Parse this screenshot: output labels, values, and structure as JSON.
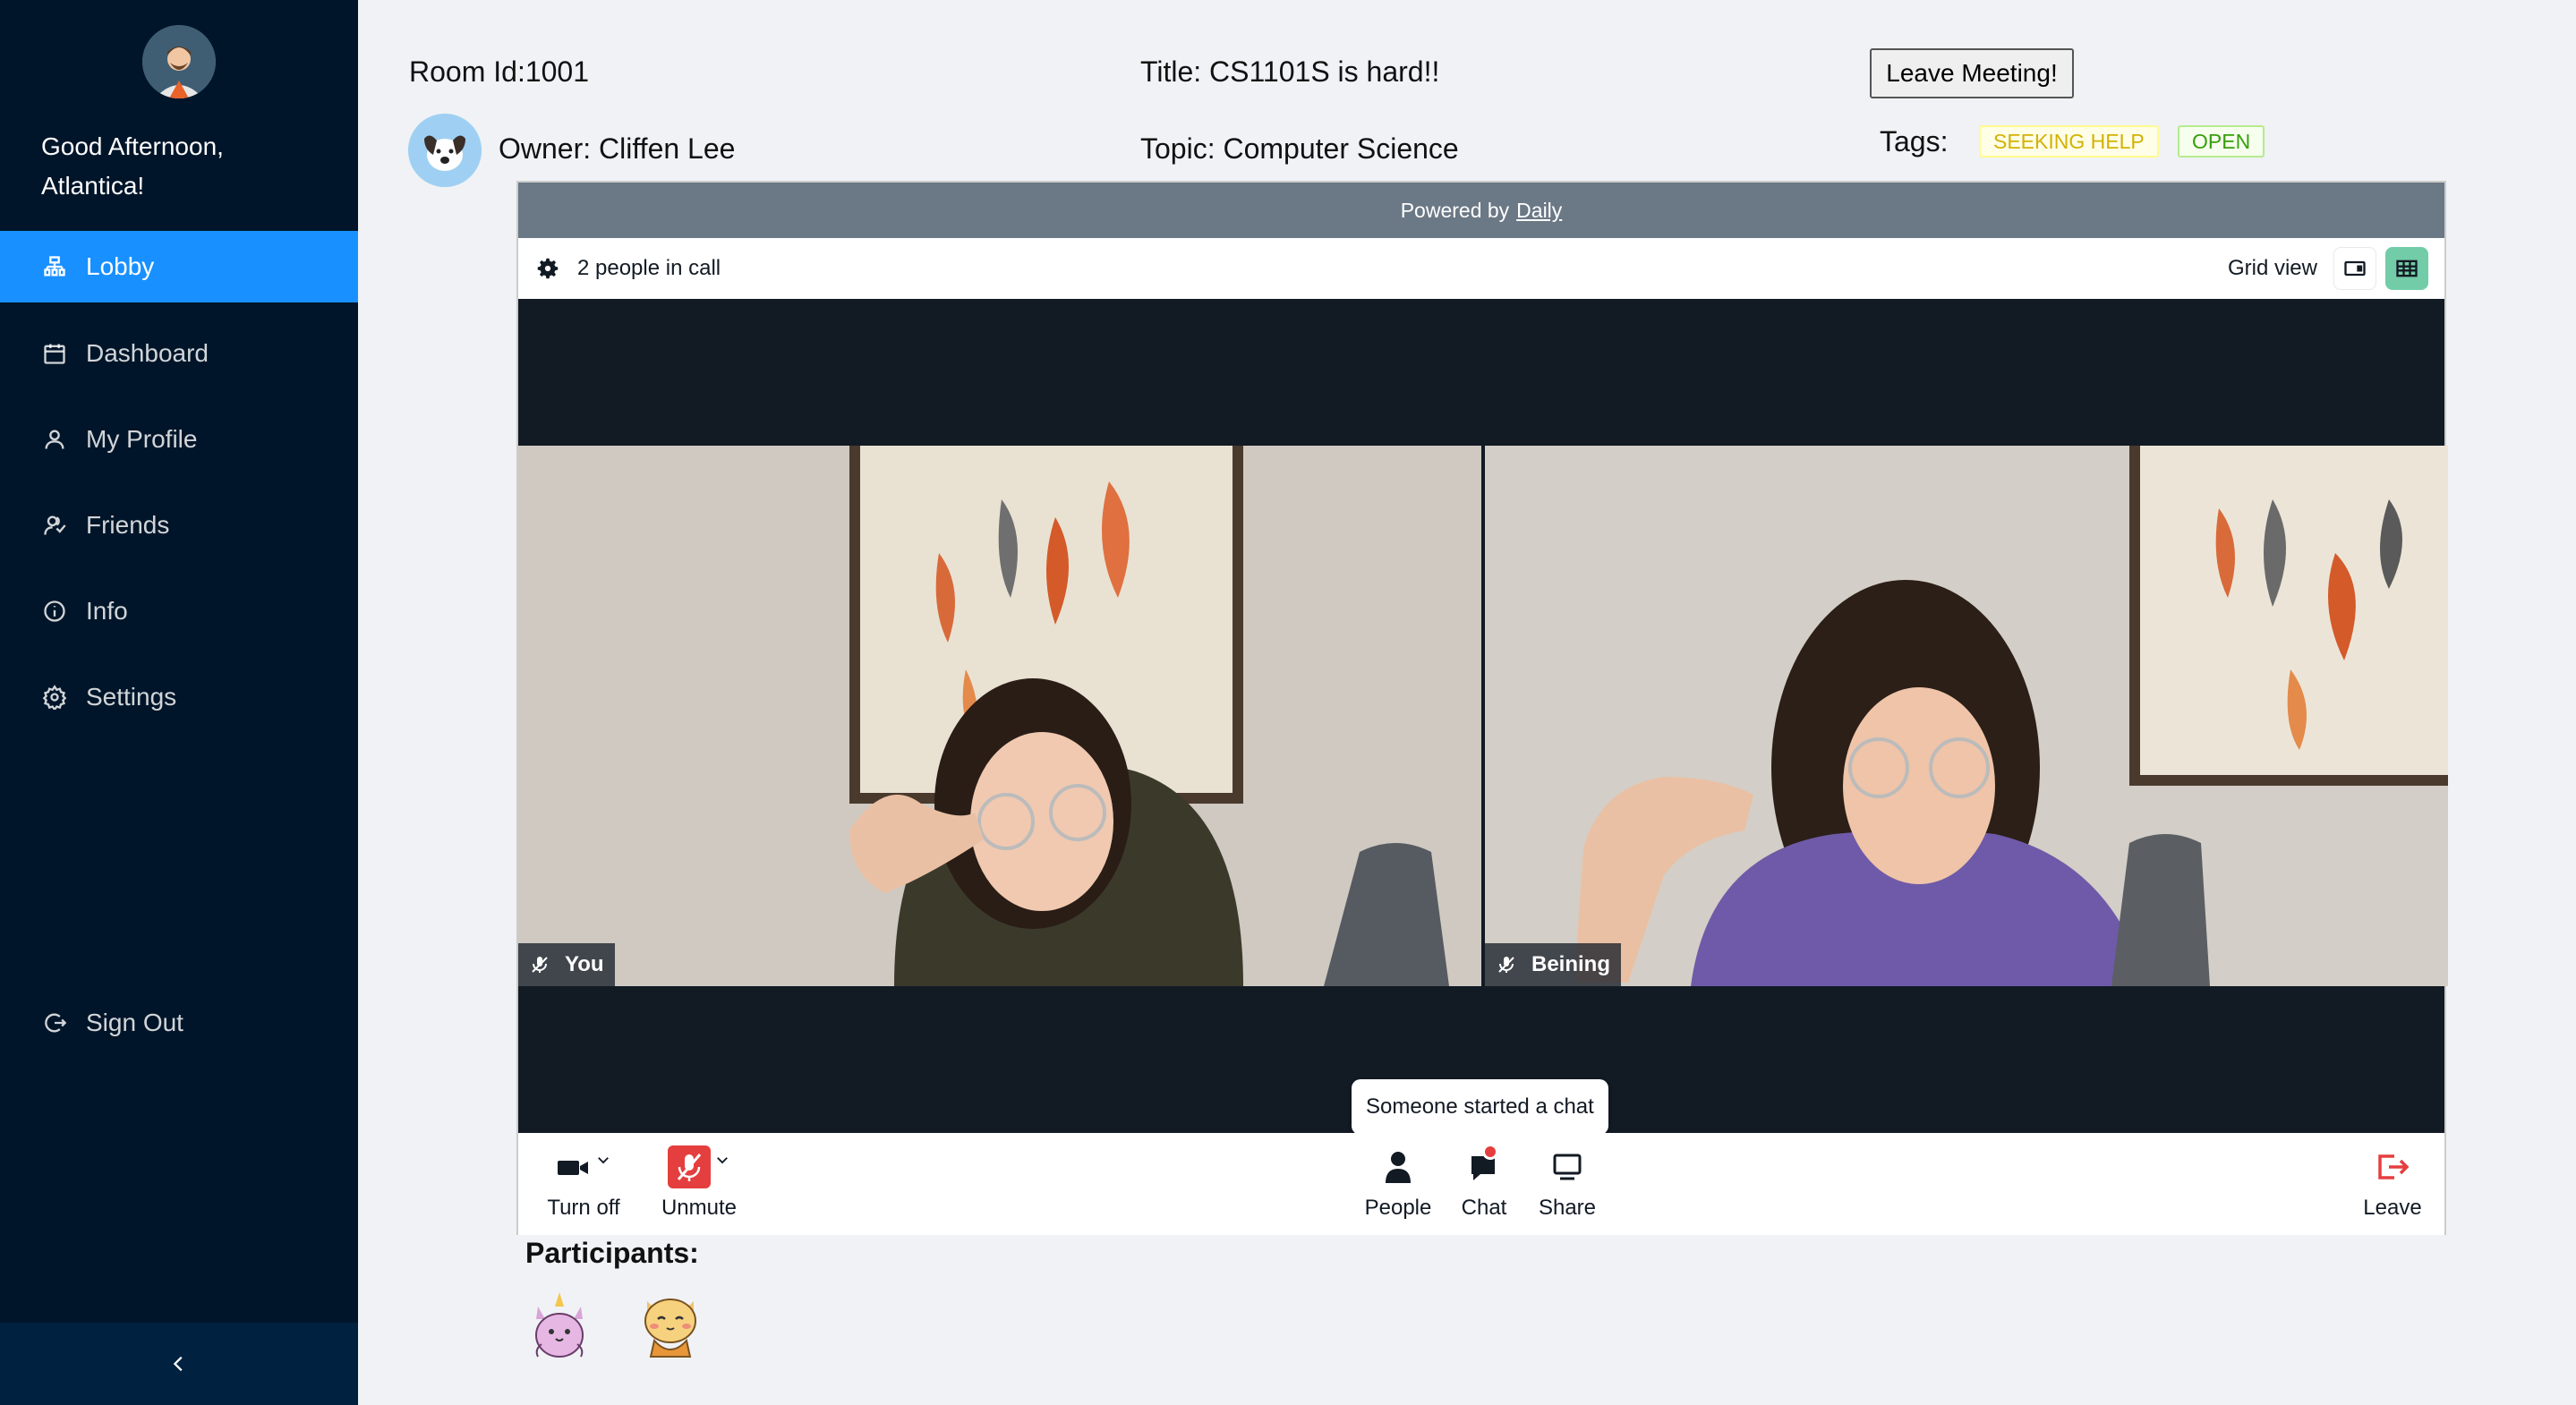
{
  "sidebar": {
    "greeting": "Good Afternoon, Atlantica!",
    "items": [
      {
        "label": "Lobby",
        "icon": "lobby-icon",
        "active": true
      },
      {
        "label": "Dashboard",
        "icon": "calendar-icon"
      },
      {
        "label": "My Profile",
        "icon": "user-icon"
      },
      {
        "label": "Friends",
        "icon": "friends-icon"
      },
      {
        "label": "Info",
        "icon": "info-icon"
      },
      {
        "label": "Settings",
        "icon": "gear-icon"
      }
    ],
    "sign_out": "Sign Out",
    "collapse_glyph": "<"
  },
  "room": {
    "room_id": "Room Id:1001",
    "title": "Title: CS1101S is hard!!",
    "owner": "Owner: Cliffen Lee",
    "topic": "Topic: Computer Science",
    "leave_button": "Leave Meeting!",
    "tags_label": "Tags:",
    "tags": [
      "SEEKING HELP",
      "OPEN"
    ]
  },
  "call": {
    "powered_by": "Powered by",
    "powered_link": "Daily",
    "people_count": "2 people in call",
    "view_label": "Grid view",
    "tiles": [
      {
        "name": "You",
        "muted": true
      },
      {
        "name": "Beining",
        "muted": true
      }
    ],
    "tooltip": "Someone started a chat",
    "tray": {
      "camera": "Turn off",
      "mic": "Unmute",
      "people": "People",
      "chat": "Chat",
      "share": "Share",
      "leave": "Leave"
    }
  },
  "participants": {
    "title": "Participants:",
    "icons": [
      "unicorn-cat-icon",
      "cat-icon"
    ]
  },
  "colors": {
    "sidebar_bg": "#001529",
    "active_item": "#1890ff",
    "call_bg": "#121a24",
    "grid_active": "#72cca7",
    "danger": "#e53e3e"
  }
}
